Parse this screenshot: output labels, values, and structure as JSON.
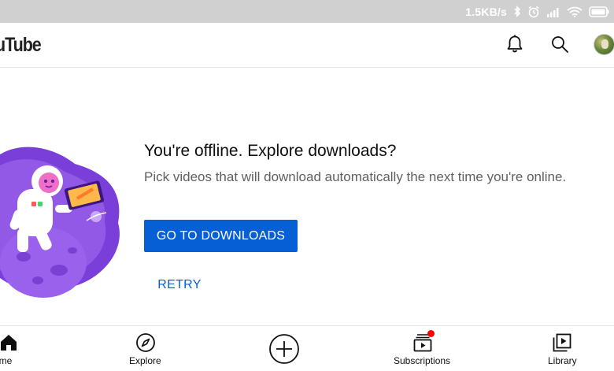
{
  "status_bar": {
    "network_speed": "1.5KB/s",
    "icons": [
      "bluetooth-icon",
      "alarm-icon",
      "signal-icon",
      "wifi-icon",
      "battery-icon"
    ]
  },
  "header": {
    "logo_text": "uTube",
    "icons": [
      "notifications-bell-icon",
      "search-icon",
      "account-avatar"
    ]
  },
  "main": {
    "title": "You're offline. Explore downloads?",
    "description": "Pick videos that will download automatically the next time you're online.",
    "primary_button": "GO TO DOWNLOADS",
    "secondary_button": "RETRY"
  },
  "bottom_nav": {
    "items": [
      {
        "label": "ome",
        "icon": "home-icon"
      },
      {
        "label": "Explore",
        "icon": "compass-icon"
      },
      {
        "label": "",
        "icon": "create-plus-icon"
      },
      {
        "label": "Subscriptions",
        "icon": "subscriptions-icon"
      },
      {
        "label": "Library",
        "icon": "library-icon"
      }
    ]
  },
  "colors": {
    "accent_blue": "#065fd4",
    "status_bar_bg": "#d0d0d0",
    "notification_dot": "#ff0000",
    "illustration_purple": "#7b3fd9"
  }
}
